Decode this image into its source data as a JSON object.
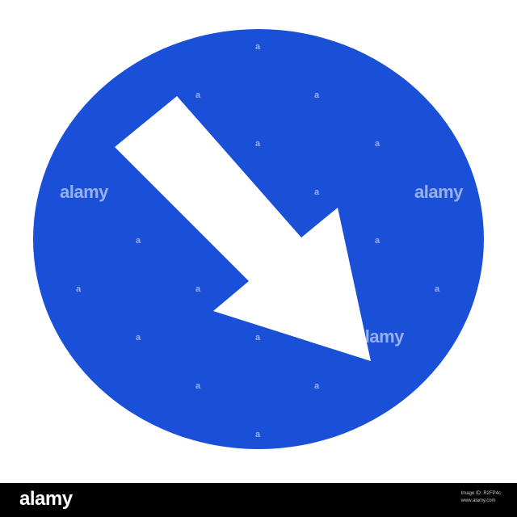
{
  "sign": {
    "circle_color": "#1a4fd8",
    "arrow_color": "#ffffff",
    "arrow_direction": "down-right"
  },
  "watermark": {
    "brand": "alamy",
    "mark": "a"
  },
  "footer": {
    "logo": "alamy",
    "image_id_line": "Image ID: R2FP4c",
    "url_line": "www.alamy.com",
    "background": "#000000"
  }
}
